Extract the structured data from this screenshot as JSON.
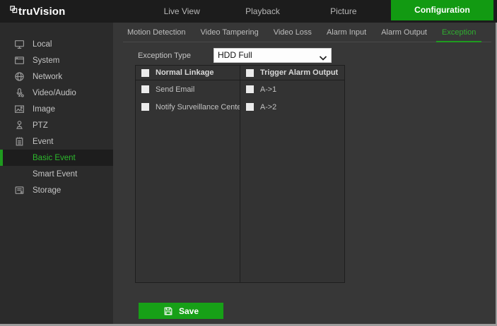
{
  "topbar": {
    "logo_text": "truVision",
    "nav_items": [
      "Live View",
      "Playback",
      "Picture",
      "Configuration"
    ],
    "active_nav": "Configuration"
  },
  "sidebar": {
    "items": [
      {
        "label": "Local",
        "icon": "monitor-icon"
      },
      {
        "label": "System",
        "icon": "window-icon"
      },
      {
        "label": "Network",
        "icon": "globe-icon"
      },
      {
        "label": "Video/Audio",
        "icon": "microphone-icon"
      },
      {
        "label": "Image",
        "icon": "image-icon"
      },
      {
        "label": "PTZ",
        "icon": "ptz-icon"
      },
      {
        "label": "Event",
        "icon": "event-icon"
      },
      {
        "label": "Basic Event",
        "indent": true,
        "active": true
      },
      {
        "label": "Smart Event",
        "indent": true
      },
      {
        "label": "Storage",
        "icon": "storage-icon"
      }
    ]
  },
  "tabs": {
    "items": [
      "Motion Detection",
      "Video Tampering",
      "Video Loss",
      "Alarm Input",
      "Alarm Output",
      "Exception"
    ],
    "active": "Exception"
  },
  "exception_form": {
    "label": "Exception Type",
    "selected_value": "HDD Full"
  },
  "linkage_panel": {
    "columns": [
      {
        "header": "Normal Linkage",
        "header_checked": false,
        "items": [
          {
            "label": "Send Email",
            "checked": false
          },
          {
            "label": "Notify Surveillance Center",
            "checked": false
          }
        ]
      },
      {
        "header": "Trigger Alarm Output",
        "header_checked": false,
        "items": [
          {
            "label": "A->1",
            "checked": false
          },
          {
            "label": "A->2",
            "checked": false
          }
        ]
      }
    ]
  },
  "save_button": {
    "label": "Save"
  },
  "colors": {
    "accent_green": "#149b14",
    "active_tab_green": "#2fae2f",
    "sidebar_active_green": "#2db82d",
    "topbar_bg": "#1c1c1c",
    "sidebar_bg": "#2b2b2b",
    "main_bg": "#373737",
    "panel_bg": "#333333",
    "panel_border": "#1e1e1e"
  }
}
